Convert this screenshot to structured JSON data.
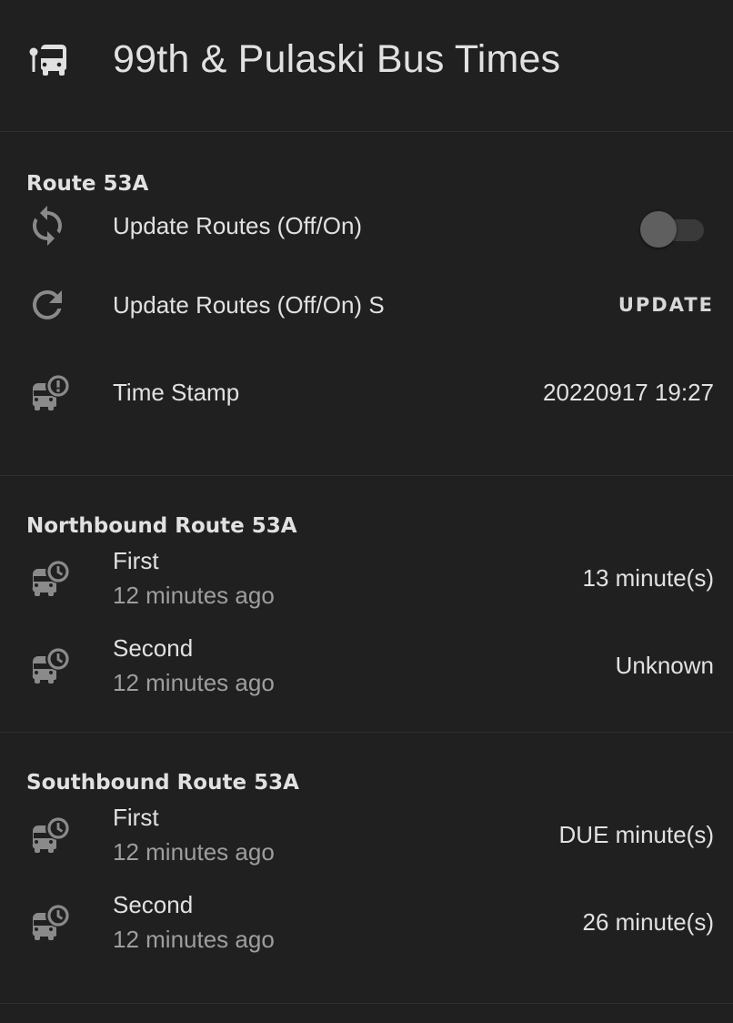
{
  "header": {
    "title": "99th & Pulaski Bus Times",
    "icon": "bus-stop-icon"
  },
  "colors": {
    "background": "#202020",
    "text": "#e1e1e1",
    "secondary": "#9e9e9e",
    "icon": "#8a8a8a"
  },
  "route": {
    "section_title": "Route 53A",
    "toggle_label": "Update Routes (Off/On)",
    "toggle_on": false,
    "script_label": "Update Routes (Off/On) S",
    "script_button": "UPDATE",
    "timestamp_label": "Time Stamp",
    "timestamp_value": "20220917 19:27"
  },
  "northbound": {
    "section_title": "Northbound Route 53A",
    "rows": [
      {
        "label": "First",
        "sub": "12 minutes ago",
        "value": "13 minute(s)"
      },
      {
        "label": "Second",
        "sub": "12 minutes ago",
        "value": "Unknown"
      }
    ]
  },
  "southbound": {
    "section_title": "Southbound Route 53A",
    "rows": [
      {
        "label": "First",
        "sub": "12 minutes ago",
        "value": "DUE minute(s)"
      },
      {
        "label": "Second",
        "sub": "12 minutes ago",
        "value": "26 minute(s)"
      }
    ]
  }
}
